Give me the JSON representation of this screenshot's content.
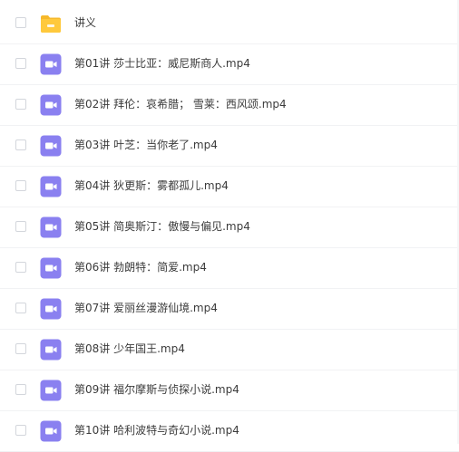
{
  "colors": {
    "folder": "#ffc93c",
    "folder_back": "#f6b82a",
    "video": "#8a80f0",
    "text": "#3b3b3b",
    "checkbox_border": "#d3d6dc",
    "divider": "#f1f2f4"
  },
  "files": [
    {
      "name": "讲义",
      "type": "folder",
      "icon": "folder-icon"
    },
    {
      "name": "第01讲 莎士比亚：威尼斯商人.mp4",
      "type": "video",
      "icon": "video-file-icon"
    },
    {
      "name": "第02讲 拜伦：哀希腊； 雪莱：西风颂.mp4",
      "type": "video",
      "icon": "video-file-icon"
    },
    {
      "name": "第03讲 叶芝：当你老了.mp4",
      "type": "video",
      "icon": "video-file-icon"
    },
    {
      "name": "第04讲 狄更斯：雾都孤儿.mp4",
      "type": "video",
      "icon": "video-file-icon"
    },
    {
      "name": "第05讲 简奥斯汀：傲慢与偏见.mp4",
      "type": "video",
      "icon": "video-file-icon"
    },
    {
      "name": "第06讲 勃朗特：简爱.mp4",
      "type": "video",
      "icon": "video-file-icon"
    },
    {
      "name": "第07讲 爱丽丝漫游仙境.mp4",
      "type": "video",
      "icon": "video-file-icon"
    },
    {
      "name": "第08讲 少年国王.mp4",
      "type": "video",
      "icon": "video-file-icon"
    },
    {
      "name": "第09讲 福尔摩斯与侦探小说.mp4",
      "type": "video",
      "icon": "video-file-icon"
    },
    {
      "name": "第10讲 哈利波特与奇幻小说.mp4",
      "type": "video",
      "icon": "video-file-icon"
    }
  ]
}
